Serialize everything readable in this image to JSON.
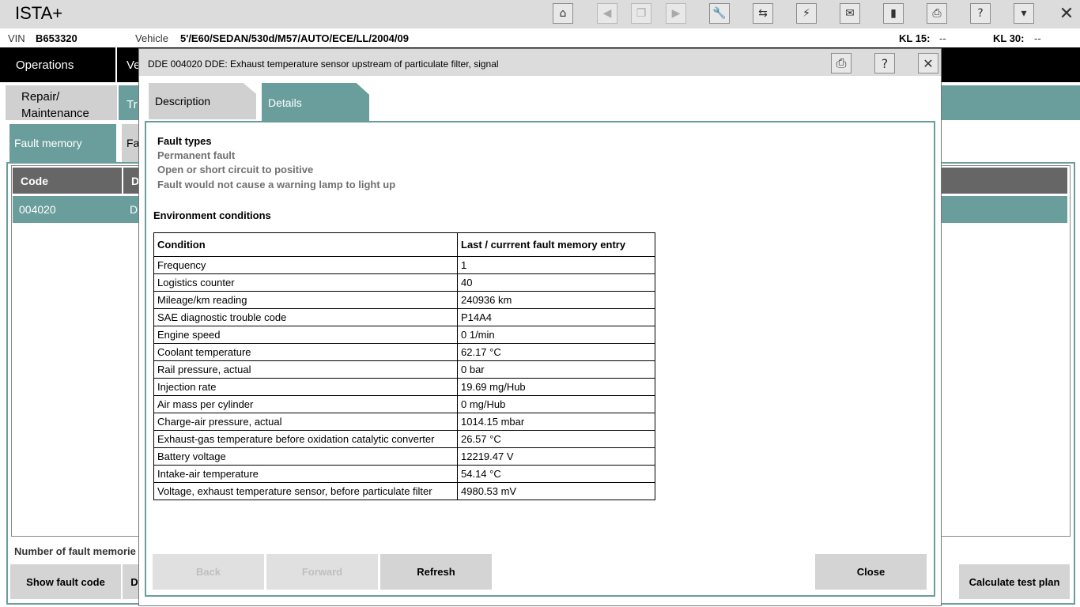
{
  "app": {
    "title": "ISTA+"
  },
  "toolbar": {
    "icons": [
      "home-icon",
      "back-icon",
      "copy-icon",
      "forward-icon",
      "wrench-icon",
      "compare-icon",
      "plug-icon",
      "mail-icon",
      "battery-icon",
      "print-icon",
      "help-icon",
      "dropdown-icon",
      "close-icon"
    ]
  },
  "vehicle_bar": {
    "vin_label": "VIN",
    "vin_value": "B653320",
    "vehicle_label": "Vehicle",
    "vehicle_value": "5'/E60/SEDAN/530d/M57/AUTO/ECE/LL/2004/09",
    "kl15_label": "KL 15:",
    "kl15_value": "--",
    "kl30_label": "KL 30:",
    "kl30_value": "--"
  },
  "nav": {
    "operations": "Operations",
    "vehicle_partial": "Ve"
  },
  "subnav": {
    "repair_line1": "Repair/",
    "repair_line2": "Maintenance",
    "partial": "Tr"
  },
  "tabs3": {
    "fault_memory": "Fault memory",
    "partial": "Fa"
  },
  "grid": {
    "col_code": "Code",
    "col_d": "D",
    "row_code": "004020",
    "row_d": "D"
  },
  "background": {
    "fault_count_label": "Number of fault memorie",
    "show_fault_code": "Show fault code",
    "partial_btn": "D",
    "calculate_test_plan": "Calculate test plan"
  },
  "modal": {
    "title": "DDE 004020 DDE: Exhaust temperature sensor upstream of particulate filter, signal",
    "tab_description": "Description",
    "tab_details": "Details",
    "fault_types_title": "Fault types",
    "fault_types": [
      "Permanent fault",
      "Open or short circuit to positive",
      "Fault would not cause a warning lamp to light up"
    ],
    "env_title": "Environment conditions",
    "table_headers": [
      "Condition",
      "Last / currrent fault memory entry"
    ],
    "table_rows": [
      [
        "Frequency",
        "1"
      ],
      [
        "Logistics counter",
        "40"
      ],
      [
        "Mileage/km reading",
        "240936 km"
      ],
      [
        "SAE diagnostic trouble code",
        "P14A4"
      ],
      [
        "Engine speed",
        "0 1/min"
      ],
      [
        "Coolant temperature",
        "62.17 °C"
      ],
      [
        "Rail pressure, actual",
        "0 bar"
      ],
      [
        "Injection rate",
        "19.69 mg/Hub"
      ],
      [
        "Air mass per cylinder",
        "0 mg/Hub"
      ],
      [
        "Charge-air pressure, actual",
        "1014.15 mbar"
      ],
      [
        "Exhaust-gas temperature before oxidation catalytic converter",
        "26.57 °C"
      ],
      [
        "Battery voltage",
        "12219.47 V"
      ],
      [
        "Intake-air temperature",
        "54.14 °C"
      ],
      [
        "Voltage, exhaust temperature sensor, before particulate filter",
        "4980.53 mV"
      ]
    ],
    "buttons": {
      "back": "Back",
      "forward": "Forward",
      "refresh": "Refresh",
      "close": "Close"
    }
  }
}
